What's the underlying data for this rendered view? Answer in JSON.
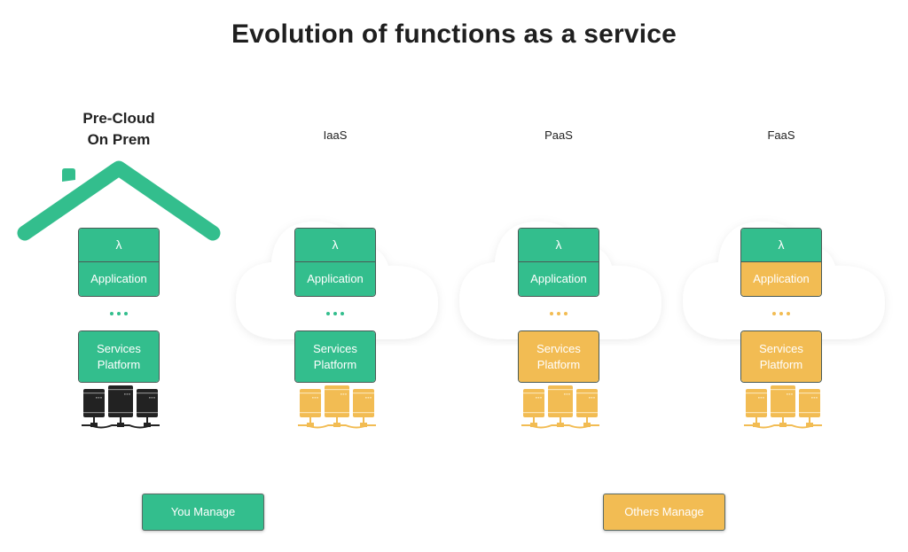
{
  "title": "Evolution of functions as a service",
  "colors": {
    "you_manage": "#33be8d",
    "others_manage": "#f2bc53",
    "on_prem_servers": "#222222"
  },
  "columns": [
    {
      "label_line1": "Pre-Cloud",
      "label_line2": "On Prem",
      "environment": "house-icon",
      "lambda": "λ",
      "application": "Application",
      "services_line1": "Services",
      "services_line2": "Platform",
      "lambda_managed_by": "you",
      "application_managed_by": "you",
      "services_managed_by": "you",
      "servers_managed_by": "you"
    },
    {
      "label": "IaaS",
      "environment": "cloud-icon",
      "lambda": "λ",
      "application": "Application",
      "services_line1": "Services",
      "services_line2": "Platform",
      "lambda_managed_by": "you",
      "application_managed_by": "you",
      "services_managed_by": "you",
      "servers_managed_by": "others"
    },
    {
      "label": "PaaS",
      "environment": "cloud-icon",
      "lambda": "λ",
      "application": "Application",
      "services_line1": "Services",
      "services_line2": "Platform",
      "lambda_managed_by": "you",
      "application_managed_by": "you",
      "services_managed_by": "others",
      "servers_managed_by": "others"
    },
    {
      "label": "FaaS",
      "environment": "cloud-icon",
      "lambda": "λ",
      "application": "Application",
      "services_line1": "Services",
      "services_line2": "Platform",
      "lambda_managed_by": "you",
      "application_managed_by": "others",
      "services_managed_by": "others",
      "servers_managed_by": "others"
    }
  ],
  "legend": {
    "you_manage": "You Manage",
    "others_manage": "Others Manage"
  }
}
